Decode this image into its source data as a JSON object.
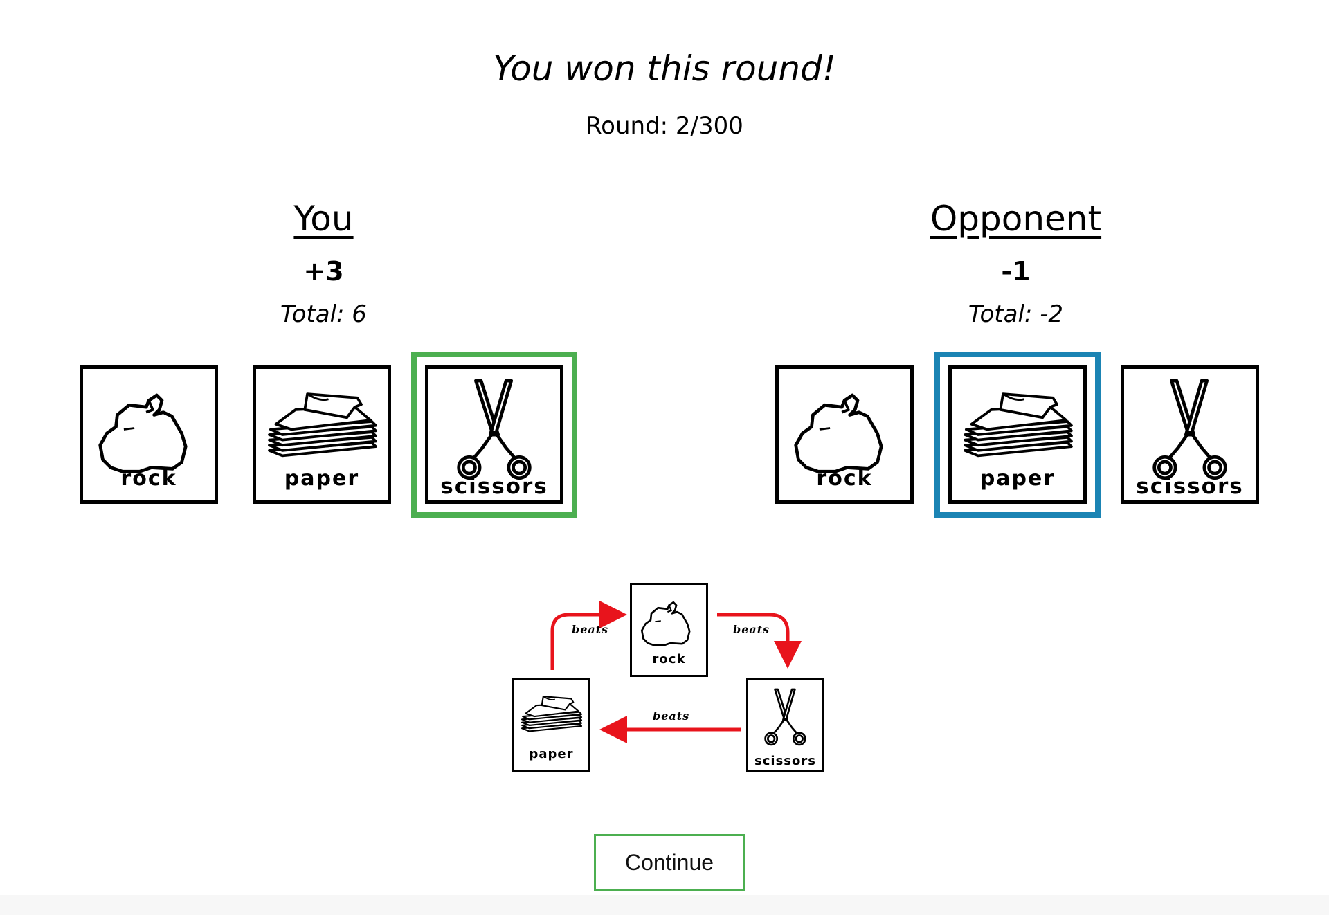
{
  "result": {
    "title": "You won this round!",
    "round_text": "Round: 2/300"
  },
  "player": {
    "name": "You",
    "delta": "+3",
    "total": "Total: 6",
    "selected_choice": "scissors",
    "highlight_color": "#4caf50"
  },
  "opponent": {
    "name": "Opponent",
    "delta": "-1",
    "total": "Total: -2",
    "selected_choice": "paper",
    "highlight_color": "#1b84b4"
  },
  "choices": [
    {
      "id": "rock",
      "label": "rock",
      "icon": "rock-icon"
    },
    {
      "id": "paper",
      "label": "paper",
      "icon": "paper-stack-icon"
    },
    {
      "id": "scissors",
      "label": "scissors",
      "icon": "scissors-icon"
    }
  ],
  "rules_diagram": {
    "beats_label": "beats",
    "arrow_color": "#e8141c",
    "relations": [
      {
        "winner": "paper",
        "loser": "rock"
      },
      {
        "winner": "rock",
        "loser": "scissors"
      },
      {
        "winner": "scissors",
        "loser": "paper"
      }
    ]
  },
  "continue_button": {
    "label": "Continue",
    "border_color": "#4caf50"
  }
}
